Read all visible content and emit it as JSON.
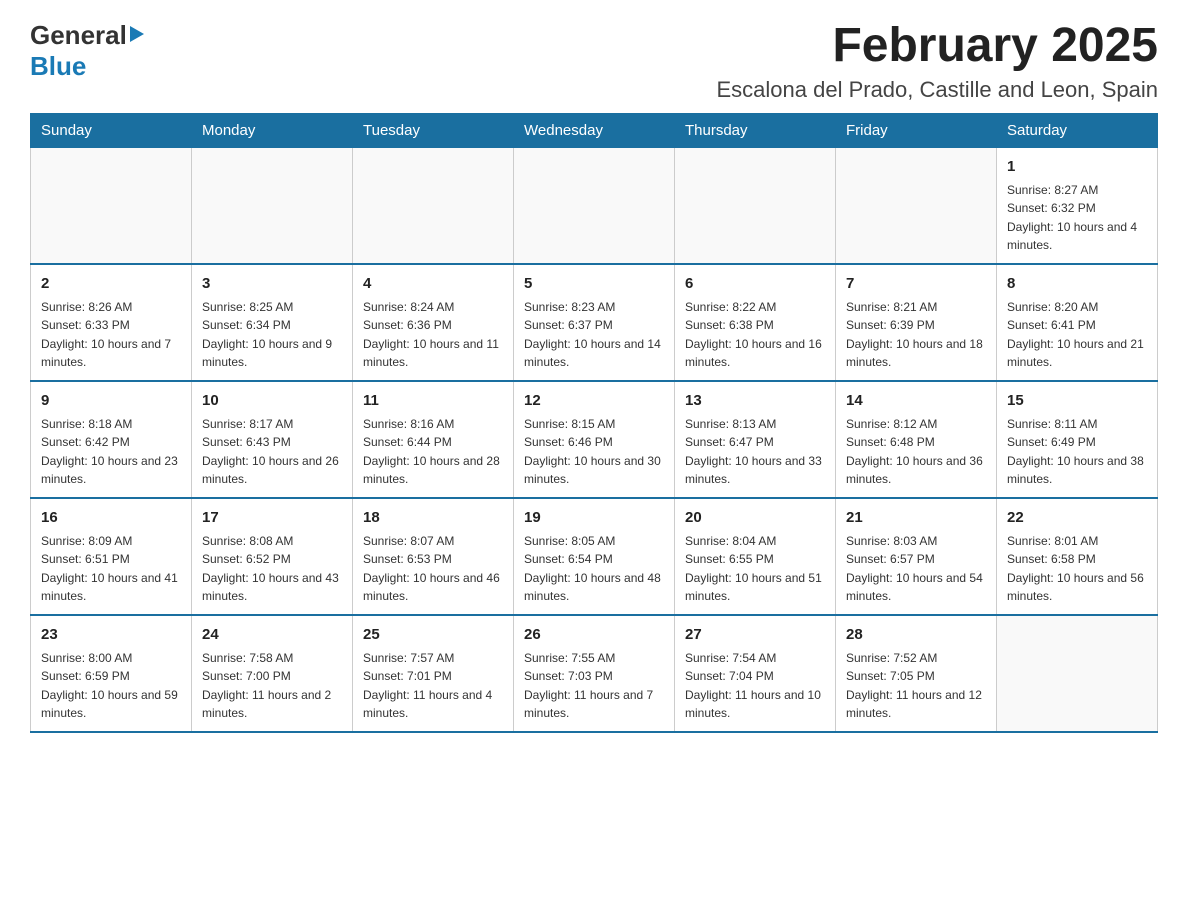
{
  "logo": {
    "line1": "General",
    "arrow": "▶",
    "line2": "Blue"
  },
  "title": "February 2025",
  "subtitle": "Escalona del Prado, Castille and Leon, Spain",
  "weekdays": [
    "Sunday",
    "Monday",
    "Tuesday",
    "Wednesday",
    "Thursday",
    "Friday",
    "Saturday"
  ],
  "weeks": [
    [
      {
        "day": "",
        "info": ""
      },
      {
        "day": "",
        "info": ""
      },
      {
        "day": "",
        "info": ""
      },
      {
        "day": "",
        "info": ""
      },
      {
        "day": "",
        "info": ""
      },
      {
        "day": "",
        "info": ""
      },
      {
        "day": "1",
        "info": "Sunrise: 8:27 AM\nSunset: 6:32 PM\nDaylight: 10 hours and 4 minutes."
      }
    ],
    [
      {
        "day": "2",
        "info": "Sunrise: 8:26 AM\nSunset: 6:33 PM\nDaylight: 10 hours and 7 minutes."
      },
      {
        "day": "3",
        "info": "Sunrise: 8:25 AM\nSunset: 6:34 PM\nDaylight: 10 hours and 9 minutes."
      },
      {
        "day": "4",
        "info": "Sunrise: 8:24 AM\nSunset: 6:36 PM\nDaylight: 10 hours and 11 minutes."
      },
      {
        "day": "5",
        "info": "Sunrise: 8:23 AM\nSunset: 6:37 PM\nDaylight: 10 hours and 14 minutes."
      },
      {
        "day": "6",
        "info": "Sunrise: 8:22 AM\nSunset: 6:38 PM\nDaylight: 10 hours and 16 minutes."
      },
      {
        "day": "7",
        "info": "Sunrise: 8:21 AM\nSunset: 6:39 PM\nDaylight: 10 hours and 18 minutes."
      },
      {
        "day": "8",
        "info": "Sunrise: 8:20 AM\nSunset: 6:41 PM\nDaylight: 10 hours and 21 minutes."
      }
    ],
    [
      {
        "day": "9",
        "info": "Sunrise: 8:18 AM\nSunset: 6:42 PM\nDaylight: 10 hours and 23 minutes."
      },
      {
        "day": "10",
        "info": "Sunrise: 8:17 AM\nSunset: 6:43 PM\nDaylight: 10 hours and 26 minutes."
      },
      {
        "day": "11",
        "info": "Sunrise: 8:16 AM\nSunset: 6:44 PM\nDaylight: 10 hours and 28 minutes."
      },
      {
        "day": "12",
        "info": "Sunrise: 8:15 AM\nSunset: 6:46 PM\nDaylight: 10 hours and 30 minutes."
      },
      {
        "day": "13",
        "info": "Sunrise: 8:13 AM\nSunset: 6:47 PM\nDaylight: 10 hours and 33 minutes."
      },
      {
        "day": "14",
        "info": "Sunrise: 8:12 AM\nSunset: 6:48 PM\nDaylight: 10 hours and 36 minutes."
      },
      {
        "day": "15",
        "info": "Sunrise: 8:11 AM\nSunset: 6:49 PM\nDaylight: 10 hours and 38 minutes."
      }
    ],
    [
      {
        "day": "16",
        "info": "Sunrise: 8:09 AM\nSunset: 6:51 PM\nDaylight: 10 hours and 41 minutes."
      },
      {
        "day": "17",
        "info": "Sunrise: 8:08 AM\nSunset: 6:52 PM\nDaylight: 10 hours and 43 minutes."
      },
      {
        "day": "18",
        "info": "Sunrise: 8:07 AM\nSunset: 6:53 PM\nDaylight: 10 hours and 46 minutes."
      },
      {
        "day": "19",
        "info": "Sunrise: 8:05 AM\nSunset: 6:54 PM\nDaylight: 10 hours and 48 minutes."
      },
      {
        "day": "20",
        "info": "Sunrise: 8:04 AM\nSunset: 6:55 PM\nDaylight: 10 hours and 51 minutes."
      },
      {
        "day": "21",
        "info": "Sunrise: 8:03 AM\nSunset: 6:57 PM\nDaylight: 10 hours and 54 minutes."
      },
      {
        "day": "22",
        "info": "Sunrise: 8:01 AM\nSunset: 6:58 PM\nDaylight: 10 hours and 56 minutes."
      }
    ],
    [
      {
        "day": "23",
        "info": "Sunrise: 8:00 AM\nSunset: 6:59 PM\nDaylight: 10 hours and 59 minutes."
      },
      {
        "day": "24",
        "info": "Sunrise: 7:58 AM\nSunset: 7:00 PM\nDaylight: 11 hours and 2 minutes."
      },
      {
        "day": "25",
        "info": "Sunrise: 7:57 AM\nSunset: 7:01 PM\nDaylight: 11 hours and 4 minutes."
      },
      {
        "day": "26",
        "info": "Sunrise: 7:55 AM\nSunset: 7:03 PM\nDaylight: 11 hours and 7 minutes."
      },
      {
        "day": "27",
        "info": "Sunrise: 7:54 AM\nSunset: 7:04 PM\nDaylight: 11 hours and 10 minutes."
      },
      {
        "day": "28",
        "info": "Sunrise: 7:52 AM\nSunset: 7:05 PM\nDaylight: 11 hours and 12 minutes."
      },
      {
        "day": "",
        "info": ""
      }
    ]
  ]
}
